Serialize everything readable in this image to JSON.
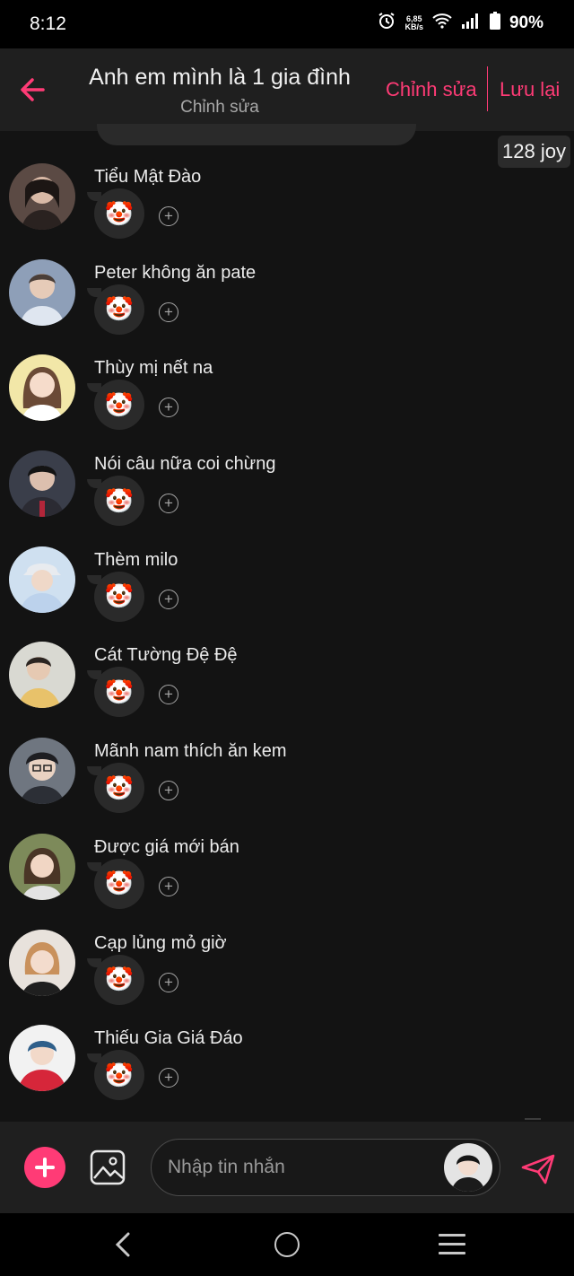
{
  "status_bar": {
    "time": "8:12",
    "speed_value": "6,85",
    "speed_unit": "KB/s",
    "battery": "90%",
    "icons": [
      "alarm-icon",
      "wifi-icon",
      "signal-icon",
      "battery-icon"
    ]
  },
  "header": {
    "title": "Anh em mình là 1 gia đình",
    "subtitle": "Chỉnh sửa",
    "edit_label": "Chỉnh sửa",
    "save_label": "Lưu lại",
    "accent_color": "#ff3b76"
  },
  "joy_badge": "128 joy",
  "members": [
    {
      "name": "Tiểu Mật Đào",
      "reaction": "🤡"
    },
    {
      "name": "Peter không ăn pate",
      "reaction": "🤡"
    },
    {
      "name": "Thùy mị nết na",
      "reaction": "🤡"
    },
    {
      "name": "Nói câu nữa coi chừng",
      "reaction": "🤡"
    },
    {
      "name": "Thèm milo",
      "reaction": "🤡"
    },
    {
      "name": "Cát Tường Đệ Đệ",
      "reaction": "🤡"
    },
    {
      "name": "Mãnh nam thích ăn kem",
      "reaction": "🤡"
    },
    {
      "name": "Được giá mới bán",
      "reaction": "🤡"
    },
    {
      "name": "Cạp lủng mỏ giờ",
      "reaction": "🤡"
    },
    {
      "name": "Thiếu Gia Giá Đáo",
      "reaction": "🤡"
    }
  ],
  "add_reaction_symbol": "+",
  "composer": {
    "placeholder": "Nhập tin nhắn"
  }
}
